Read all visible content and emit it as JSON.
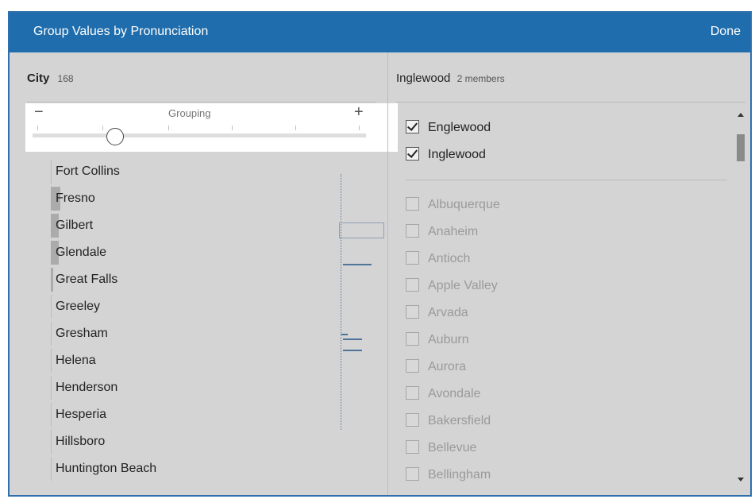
{
  "dialog": {
    "title": "Group Values by Pronunciation",
    "done_label": "Done"
  },
  "left": {
    "field_name": "City",
    "field_count": "168",
    "slider": {
      "minus": "−",
      "plus": "+",
      "label": "Grouping",
      "level": 0.22
    },
    "values": [
      "Fort Collins",
      "Fresno",
      "Gilbert",
      "Glendale",
      "Great Falls",
      "Greeley",
      "Gresham",
      "Helena",
      "Henderson",
      "Hesperia",
      "Hillsboro",
      "Huntington Beach"
    ]
  },
  "right": {
    "group_name": "Inglewood",
    "member_count": "2 members",
    "checked_members": [
      "Englewood",
      "Inglewood"
    ],
    "unchecked_members": [
      "Albuquerque",
      "Anaheim",
      "Antioch",
      "Apple Valley",
      "Arvada",
      "Auburn",
      "Aurora",
      "Avondale",
      "Bakersfield",
      "Bellevue",
      "Bellingham"
    ]
  },
  "colors": {
    "title_bar": "#1f6dac",
    "panel": "#d4d4d4",
    "marks": "#4f7399"
  }
}
